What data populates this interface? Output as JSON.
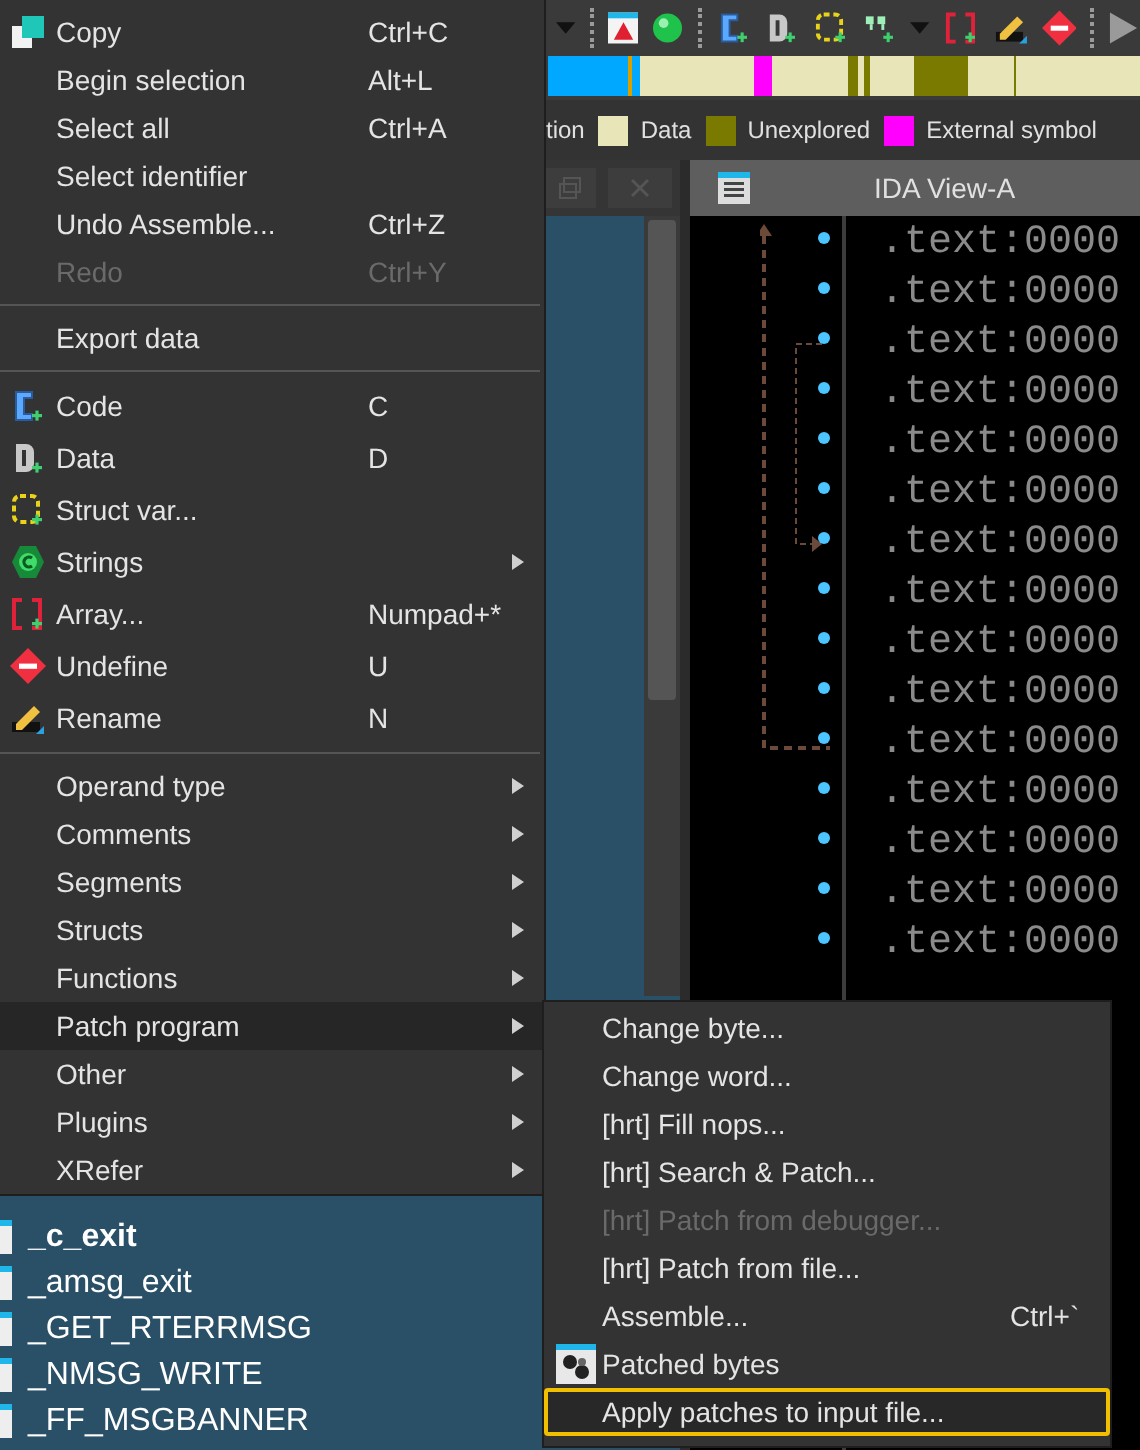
{
  "legend": [
    {
      "label": "tion"
    },
    {
      "label": "Data",
      "color": "#e8e6b8"
    },
    {
      "label": "Unexplored",
      "color": "#7a7a00"
    },
    {
      "label": "External symbol",
      "color": "#ff00ff"
    }
  ],
  "functions_panel": {
    "functions": [
      {
        "name": "_c_exit",
        "bold": true
      },
      {
        "name": "_amsg_exit",
        "bold": false
      },
      {
        "name": "_GET_RTERRMSG",
        "bold": false
      },
      {
        "name": "_NMSG_WRITE",
        "bold": false
      },
      {
        "name": "_FF_MSGBANNER",
        "bold": false
      }
    ]
  },
  "ida_view": {
    "title": "IDA View-A",
    "lines": [
      ".text:0000",
      ".text:0000",
      ".text:0000",
      ".text:0000",
      ".text:0000",
      ".text:0000",
      ".text:0000",
      ".text:0000",
      ".text:0000",
      ".text:0000",
      ".text:0000",
      ".text:0000",
      ".text:0000",
      ".text:0000",
      ".text:0000"
    ]
  },
  "context_menu": {
    "items": [
      {
        "kind": "copy",
        "label": "Copy",
        "shortcut": "Ctrl+C",
        "submenu": false,
        "disabled": false,
        "selected": false
      },
      {
        "kind": "item",
        "label": "Begin selection",
        "shortcut": "Alt+L",
        "submenu": false,
        "disabled": false,
        "selected": false
      },
      {
        "kind": "item",
        "label": "Select all",
        "shortcut": "Ctrl+A",
        "submenu": false,
        "disabled": false,
        "selected": false
      },
      {
        "kind": "item",
        "label": "Select identifier",
        "submenu": false,
        "disabled": false,
        "selected": false
      },
      {
        "kind": "item",
        "label": "Undo Assemble...",
        "shortcut": "Ctrl+Z",
        "submenu": false,
        "disabled": false,
        "selected": false
      },
      {
        "kind": "item",
        "label": "Redo",
        "shortcut": "Ctrl+Y",
        "submenu": false,
        "disabled": true,
        "selected": false
      },
      {
        "kind": "separator"
      },
      {
        "kind": "item",
        "label": "Export data",
        "submenu": false,
        "disabled": false,
        "selected": false
      },
      {
        "kind": "separator"
      },
      {
        "kind": "code",
        "label": "Code",
        "shortcut": "C",
        "submenu": false,
        "disabled": false,
        "selected": false
      },
      {
        "kind": "data",
        "label": "Data",
        "shortcut": "D",
        "submenu": false,
        "disabled": false,
        "selected": false
      },
      {
        "kind": "struct",
        "label": "Struct var...",
        "submenu": false,
        "disabled": false,
        "selected": false
      },
      {
        "kind": "strings",
        "label": "Strings",
        "submenu": true,
        "disabled": false,
        "selected": false
      },
      {
        "kind": "array",
        "label": "Array...",
        "shortcut": "Numpad+*",
        "submenu": false,
        "disabled": false,
        "selected": false
      },
      {
        "kind": "undefine",
        "label": "Undefine",
        "shortcut": "U",
        "submenu": false,
        "disabled": false,
        "selected": false
      },
      {
        "kind": "rename",
        "label": "Rename",
        "shortcut": "N",
        "submenu": false,
        "disabled": false,
        "selected": false
      },
      {
        "kind": "separator"
      },
      {
        "kind": "item",
        "label": "Operand type",
        "submenu": true,
        "disabled": false,
        "selected": false
      },
      {
        "kind": "item",
        "label": "Comments",
        "submenu": true,
        "disabled": false,
        "selected": false
      },
      {
        "kind": "item",
        "label": "Segments",
        "submenu": true,
        "disabled": false,
        "selected": false
      },
      {
        "kind": "item",
        "label": "Structs",
        "submenu": true,
        "disabled": false,
        "selected": false
      },
      {
        "kind": "item",
        "label": "Functions",
        "submenu": true,
        "disabled": false,
        "selected": false
      },
      {
        "kind": "item",
        "label": "Patch program",
        "submenu": true,
        "disabled": false,
        "selected": true
      },
      {
        "kind": "item",
        "label": "Other",
        "submenu": true,
        "disabled": false,
        "selected": false
      },
      {
        "kind": "item",
        "label": "Plugins",
        "submenu": true,
        "disabled": false,
        "selected": false
      },
      {
        "kind": "item",
        "label": "XRefer",
        "submenu": true,
        "disabled": false,
        "selected": false
      }
    ]
  },
  "patch_submenu": {
    "items": [
      {
        "label": "Change byte...",
        "disabled": false,
        "selected": false
      },
      {
        "label": "Change word...",
        "disabled": false,
        "selected": false
      },
      {
        "label": "[hrt] Fill nops...",
        "disabled": false,
        "selected": false
      },
      {
        "label": "[hrt] Search & Patch...",
        "disabled": false,
        "selected": false
      },
      {
        "label": "[hrt] Patch from debugger...",
        "disabled": true,
        "selected": false
      },
      {
        "label": "[hrt] Patch from file...",
        "disabled": false,
        "selected": false
      },
      {
        "label": "Assemble...",
        "shortcut": "Ctrl+`",
        "disabled": false,
        "selected": false
      },
      {
        "label": "Patched bytes",
        "kind": "patched",
        "disabled": false,
        "selected": false
      },
      {
        "label": "Apply patches to input file...",
        "disabled": false,
        "selected": true
      }
    ]
  }
}
